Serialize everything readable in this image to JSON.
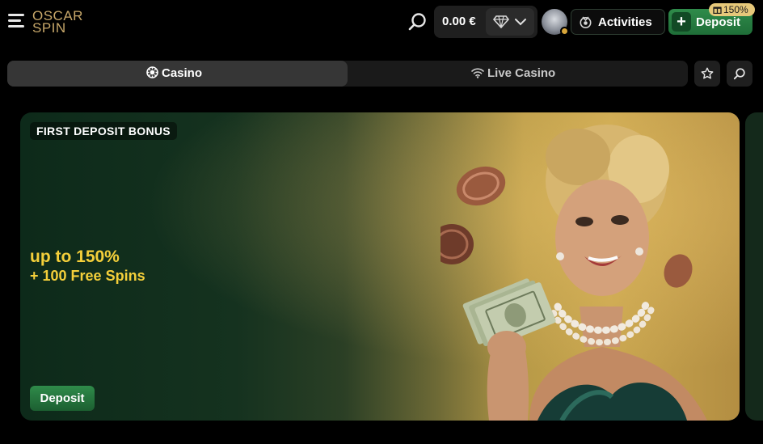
{
  "brand": {
    "logo_line1": "OSCAR",
    "logo_line2": "SPIN",
    "logo_color": "#c8a86a"
  },
  "header": {
    "balance": "0.00 €",
    "activities_label": "Activities",
    "deposit_label": "Deposit",
    "deposit_bonus_badge": "150%",
    "accent_green": "#2f8b4a",
    "badge_gold": "#e6c87a"
  },
  "tabs": [
    {
      "label": "Casino",
      "icon": "casino-chip-icon",
      "active": true
    },
    {
      "label": "Live Casino",
      "icon": "live-signal-icon",
      "active": false
    }
  ],
  "toolbar": {
    "favorites_icon": "star-icon",
    "search_icon": "search-icon"
  },
  "banner": {
    "tag": "FIRST DEPOSIT BONUS",
    "headline": "up to 150%",
    "subline": "+ 100 Free Spins",
    "cta_label": "Deposit",
    "highlight_color": "#f4cf3a"
  }
}
